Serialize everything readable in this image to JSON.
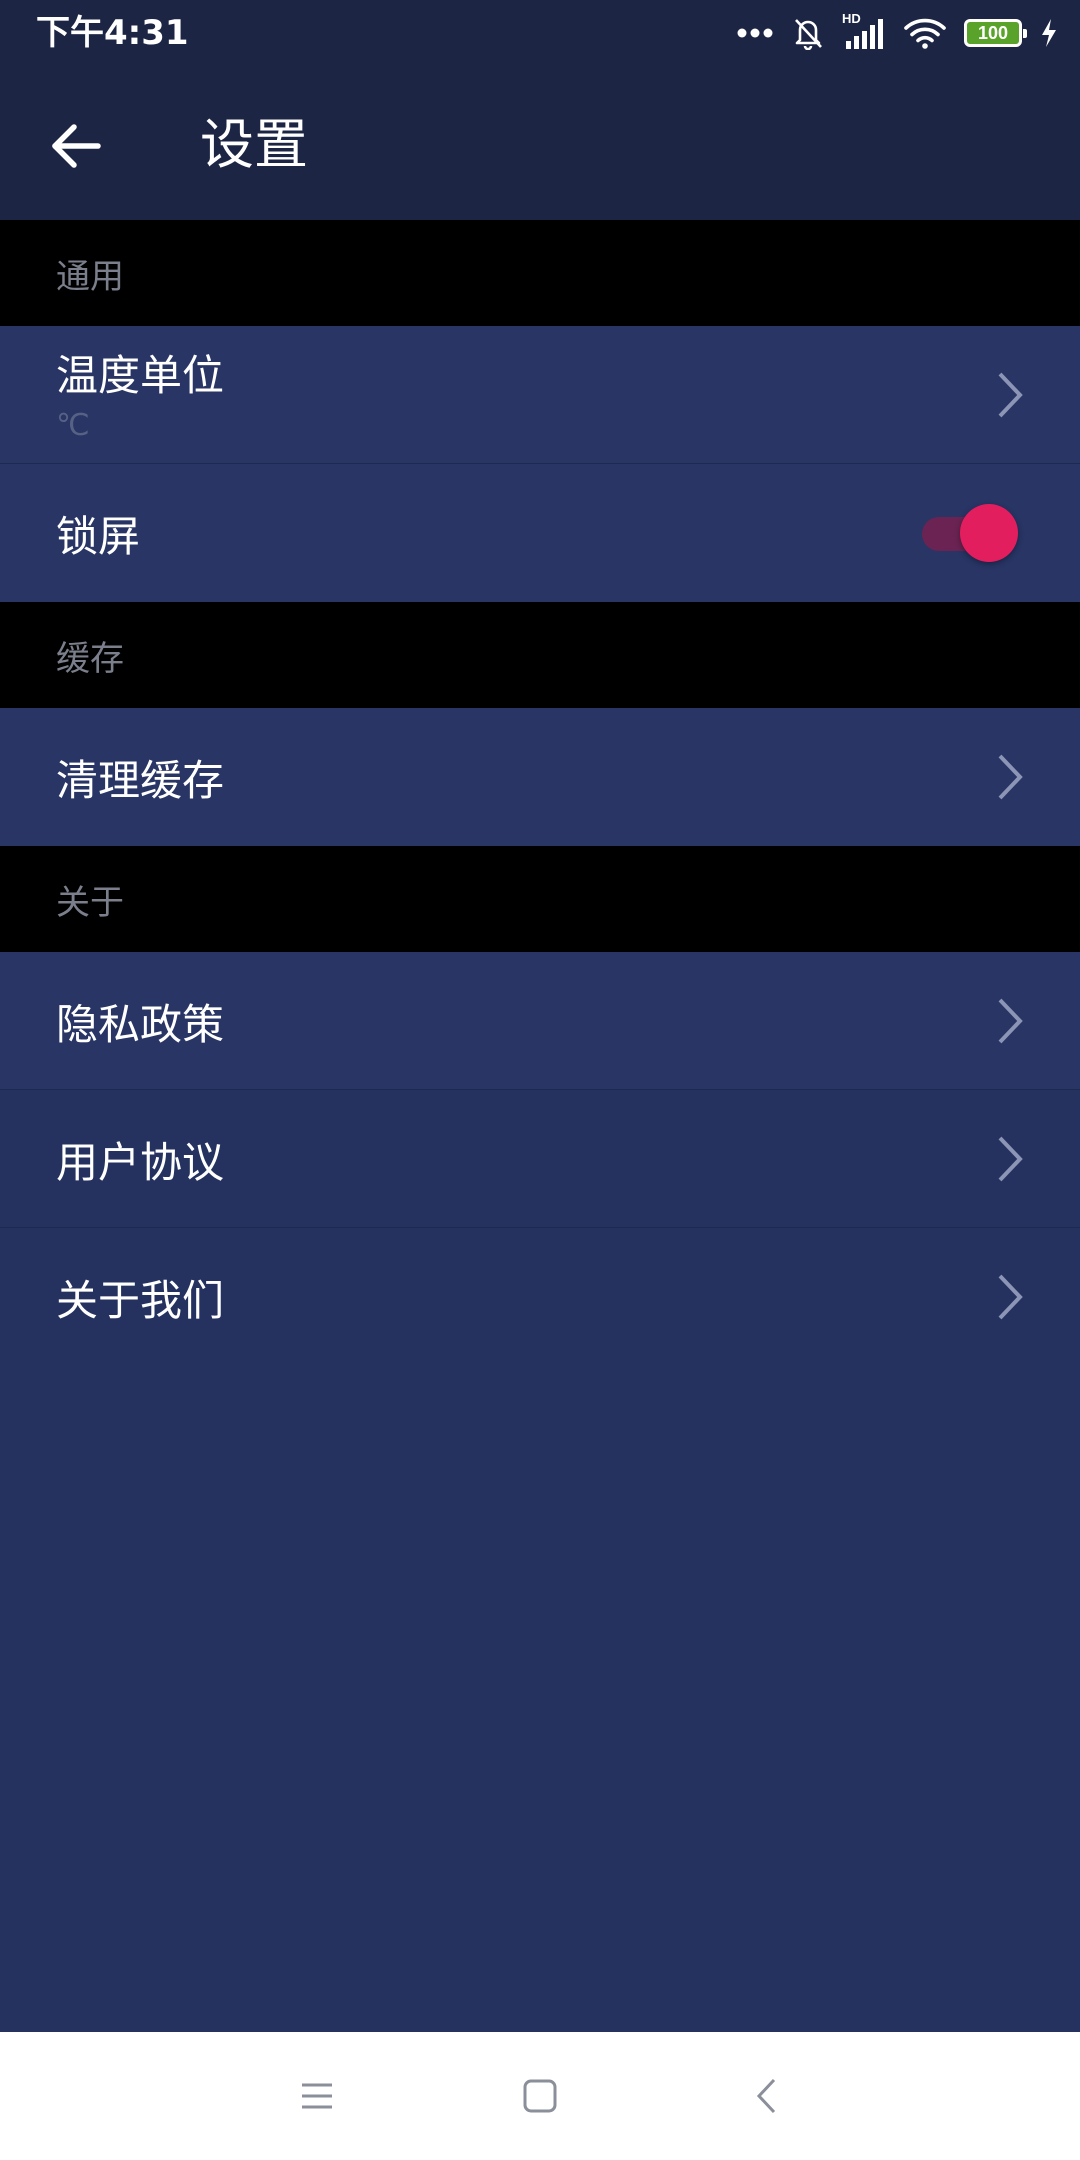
{
  "colors": {
    "app_bar": "#1c2543",
    "content_bg": "#253260",
    "row_bg": "#283565",
    "section_bg": "#000000",
    "section_text": "#7b7f8c",
    "accent": "#e21e5e"
  },
  "status_bar": {
    "time": "下午4:31",
    "network_label": "HD",
    "battery": "100",
    "icons": [
      "more-dots-icon",
      "bell-off-icon",
      "signal-icon",
      "wifi-icon",
      "battery-icon",
      "charging-icon"
    ]
  },
  "header": {
    "title": "设置",
    "back_icon": "arrow-left-icon"
  },
  "sections": {
    "general": {
      "label": "通用",
      "temperature": {
        "title": "温度单位",
        "value": "℃"
      },
      "lock_screen": {
        "title": "锁屏",
        "enabled": true
      }
    },
    "cache": {
      "label": "缓存",
      "clear": {
        "title": "清理缓存"
      }
    },
    "about": {
      "label": "关于",
      "privacy": {
        "title": "隐私政策"
      },
      "agreement": {
        "title": "用户协议"
      },
      "about_us": {
        "title": "关于我们"
      }
    }
  },
  "nav_bar": {
    "icons": [
      "menu-icon",
      "home-icon",
      "back-icon"
    ]
  }
}
